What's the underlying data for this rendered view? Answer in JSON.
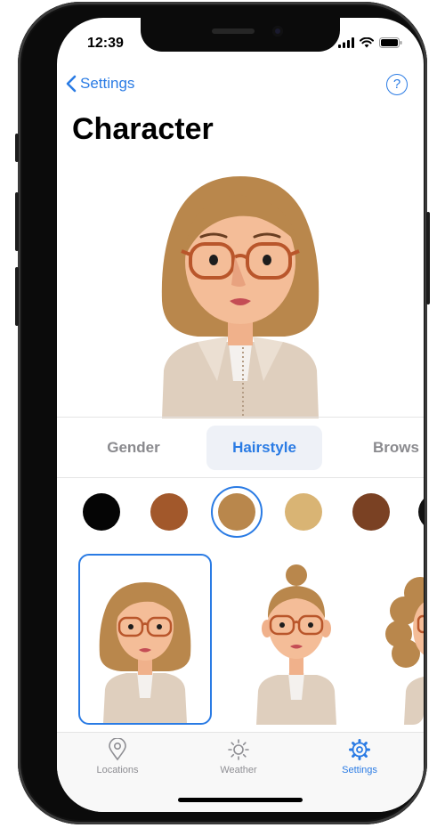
{
  "status_bar": {
    "time": "12:39"
  },
  "nav": {
    "back_label": "Settings",
    "help_label": "?"
  },
  "title": "Character",
  "tabs": [
    {
      "label": "Gender",
      "active": false
    },
    {
      "label": "Hairstyle",
      "active": true
    },
    {
      "label": "Brows",
      "active": false
    }
  ],
  "hair_colors": [
    {
      "color": "#050505",
      "selected": false
    },
    {
      "color": "#a2582b",
      "selected": false
    },
    {
      "color": "#b9874c",
      "selected": true
    },
    {
      "color": "#d9b474",
      "selected": false
    },
    {
      "color": "#7a4123",
      "selected": false
    }
  ],
  "hairstyles": [
    {
      "style": "bob",
      "selected": true
    },
    {
      "style": "bun",
      "selected": false
    },
    {
      "style": "curly",
      "selected": false
    }
  ],
  "tab_bar": {
    "items": [
      {
        "label": "Locations",
        "icon": "location-pin-icon",
        "active": false
      },
      {
        "label": "Weather",
        "icon": "sun-icon",
        "active": false
      },
      {
        "label": "Settings",
        "icon": "gear-icon",
        "active": true
      }
    ]
  },
  "colors": {
    "accent": "#2a7be4",
    "hair": "#b9874c",
    "skin": "#f4bd98",
    "jacket": "#dfcfbe",
    "glasses": "#b9562b"
  }
}
